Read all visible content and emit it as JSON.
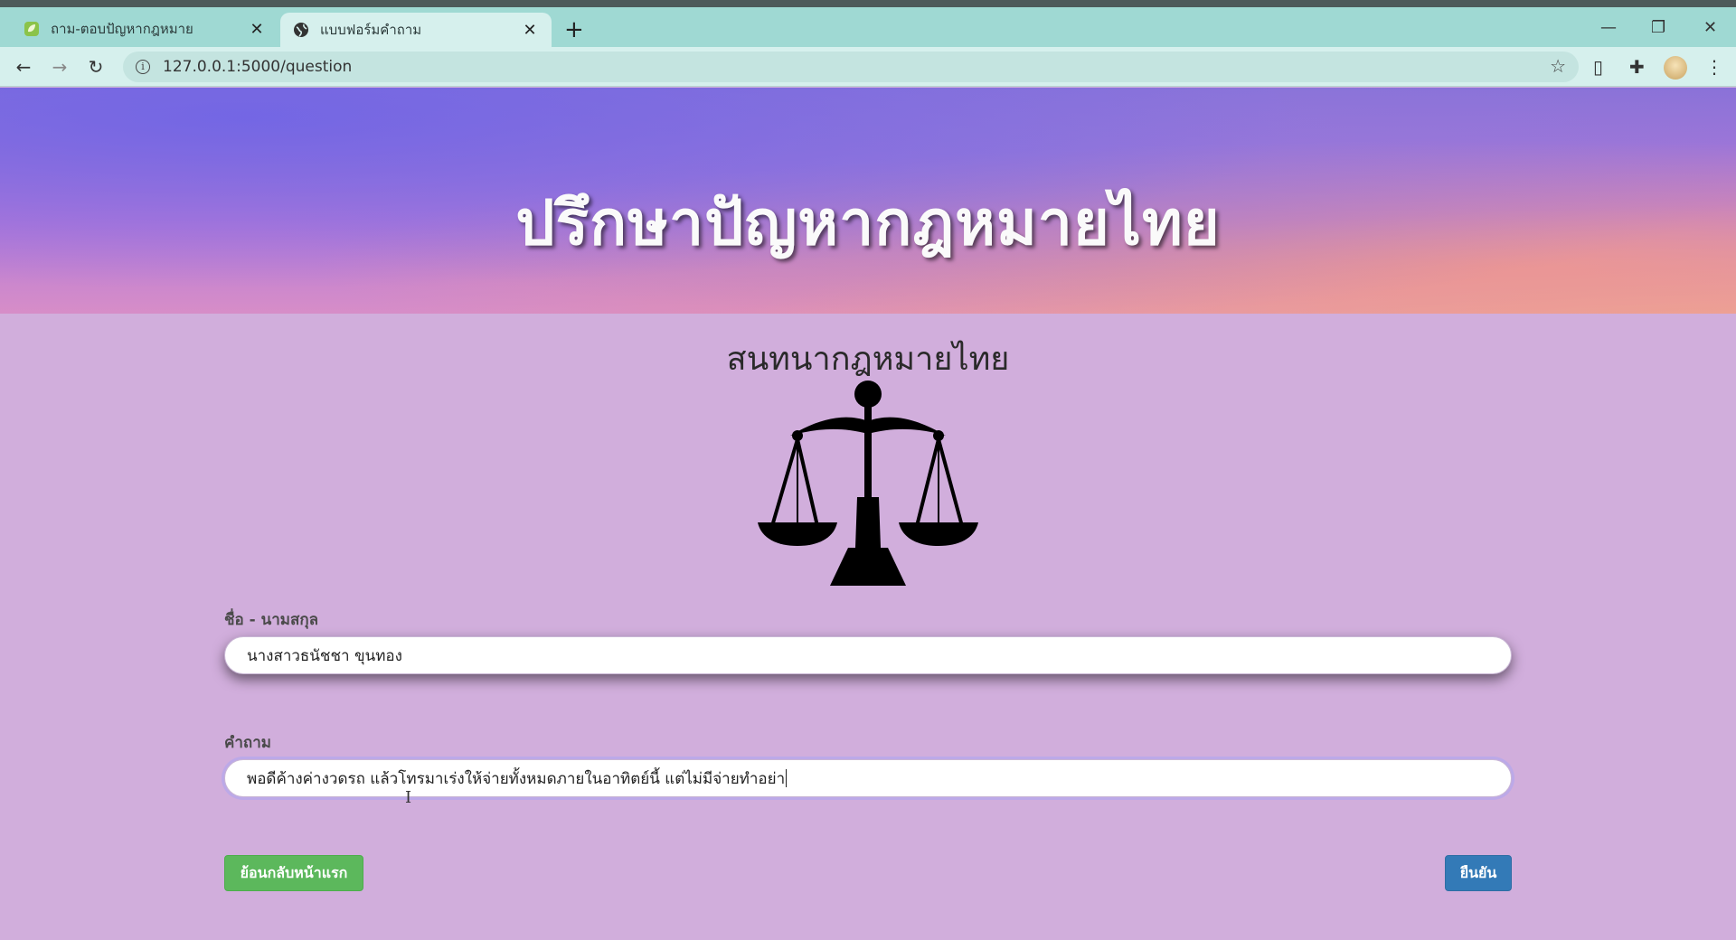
{
  "browser": {
    "tabs": [
      {
        "title": "ถาม-ตอบปัญหากฎหมาย",
        "active": false,
        "favicon": "leaf-icon"
      },
      {
        "title": "แบบฟอร์มคำถาม",
        "active": true,
        "favicon": "globe-icon"
      }
    ],
    "new_tab_label": "+",
    "url": "127.0.0.1:5000/question"
  },
  "page": {
    "hero_title": "ปรึกษาปัญหากฎหมายไทย",
    "subtitle": "สนทนากฎหมายไทย",
    "logo_icon": "scales-of-justice-icon"
  },
  "form": {
    "name_label": "ชื่อ - นามสกุล",
    "name_value": "นางสาวธนัชชา ขุนทอง",
    "question_label": "คำถาม",
    "question_value": "พอดีค้างค่างวดรถ แล้วโทรมาเร่งให้จ่ายทั้งหมดภายในอาทิตย์นี้ แต่ไม่มีจ่ายทำอย่า",
    "back_button": "ย้อนกลับหน้าแรก",
    "submit_button": "ยืนยัน"
  },
  "colors": {
    "back_button": "#5cb85c",
    "submit_button": "#337ab7",
    "page_background": "#d1aedc"
  }
}
